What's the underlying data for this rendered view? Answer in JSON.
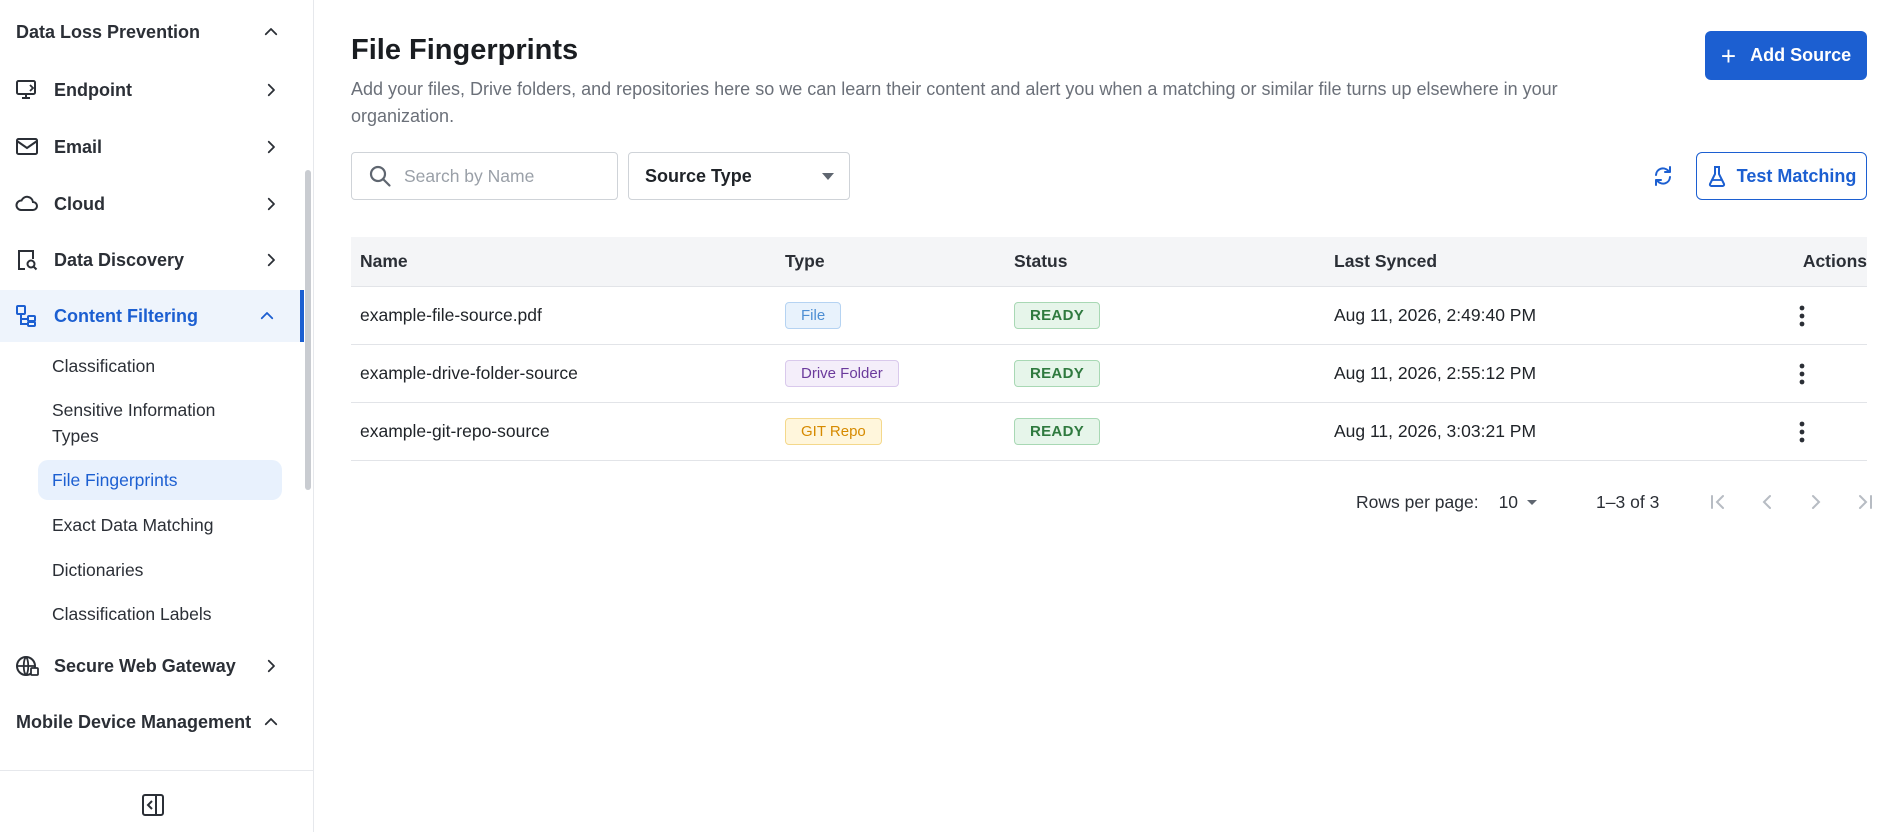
{
  "sidebar": {
    "section_dlp": "Data Loss Prevention",
    "items": [
      {
        "label": "Endpoint"
      },
      {
        "label": "Email"
      },
      {
        "label": "Cloud"
      },
      {
        "label": "Data Discovery"
      },
      {
        "label": "Content Filtering"
      },
      {
        "label": "Secure Web Gateway"
      }
    ],
    "sub_items": [
      {
        "label": "Classification"
      },
      {
        "label": "Sensitive Information Types"
      },
      {
        "label": "File Fingerprints"
      },
      {
        "label": "Exact Data Matching"
      },
      {
        "label": "Dictionaries"
      },
      {
        "label": "Classification Labels"
      }
    ],
    "section_mdm": "Mobile Device Management"
  },
  "header": {
    "title": "File Fingerprints",
    "description": "Add your files, Drive folders, and repositories here so we can learn their content and alert you when a matching or similar file turns up elsewhere in your organization.",
    "add_button": "Add Source"
  },
  "toolbar": {
    "search_placeholder": "Search by Name",
    "source_type": "Source Type",
    "test_button": "Test Matching"
  },
  "table": {
    "columns": [
      "Name",
      "Type",
      "Status",
      "Last Synced",
      "Actions"
    ],
    "rows": [
      {
        "name": "example-file-source.pdf",
        "type": "File",
        "status": "READY",
        "synced": "Aug 11, 2026, 2:49:40 PM"
      },
      {
        "name": "example-drive-folder-source",
        "type": "Drive Folder",
        "status": "READY",
        "synced": "Aug 11, 2026, 2:55:12 PM"
      },
      {
        "name": "example-git-repo-source",
        "type": "GIT Repo",
        "status": "READY",
        "synced": "Aug 11, 2026, 3:03:21 PM"
      }
    ]
  },
  "pagination": {
    "rows_label": "Rows per page:",
    "rows_value": "10",
    "range": "1–3 of 3"
  },
  "colors": {
    "accent": "#1c5fd1",
    "ready": "#2f7a3f"
  }
}
